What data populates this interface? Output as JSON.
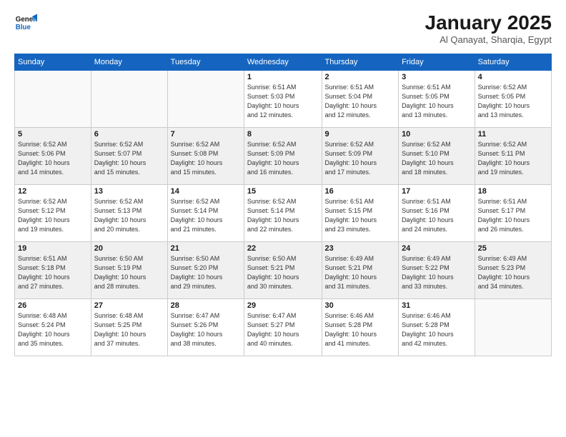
{
  "logo": {
    "line1": "General",
    "line2": "Blue"
  },
  "title": "January 2025",
  "subtitle": "Al Qanayat, Sharqia, Egypt",
  "weekdays": [
    "Sunday",
    "Monday",
    "Tuesday",
    "Wednesday",
    "Thursday",
    "Friday",
    "Saturday"
  ],
  "weeks": [
    [
      {
        "day": "",
        "info": ""
      },
      {
        "day": "",
        "info": ""
      },
      {
        "day": "",
        "info": ""
      },
      {
        "day": "1",
        "info": "Sunrise: 6:51 AM\nSunset: 5:03 PM\nDaylight: 10 hours\nand 12 minutes."
      },
      {
        "day": "2",
        "info": "Sunrise: 6:51 AM\nSunset: 5:04 PM\nDaylight: 10 hours\nand 12 minutes."
      },
      {
        "day": "3",
        "info": "Sunrise: 6:51 AM\nSunset: 5:05 PM\nDaylight: 10 hours\nand 13 minutes."
      },
      {
        "day": "4",
        "info": "Sunrise: 6:52 AM\nSunset: 5:05 PM\nDaylight: 10 hours\nand 13 minutes."
      }
    ],
    [
      {
        "day": "5",
        "info": "Sunrise: 6:52 AM\nSunset: 5:06 PM\nDaylight: 10 hours\nand 14 minutes."
      },
      {
        "day": "6",
        "info": "Sunrise: 6:52 AM\nSunset: 5:07 PM\nDaylight: 10 hours\nand 15 minutes."
      },
      {
        "day": "7",
        "info": "Sunrise: 6:52 AM\nSunset: 5:08 PM\nDaylight: 10 hours\nand 15 minutes."
      },
      {
        "day": "8",
        "info": "Sunrise: 6:52 AM\nSunset: 5:09 PM\nDaylight: 10 hours\nand 16 minutes."
      },
      {
        "day": "9",
        "info": "Sunrise: 6:52 AM\nSunset: 5:09 PM\nDaylight: 10 hours\nand 17 minutes."
      },
      {
        "day": "10",
        "info": "Sunrise: 6:52 AM\nSunset: 5:10 PM\nDaylight: 10 hours\nand 18 minutes."
      },
      {
        "day": "11",
        "info": "Sunrise: 6:52 AM\nSunset: 5:11 PM\nDaylight: 10 hours\nand 19 minutes."
      }
    ],
    [
      {
        "day": "12",
        "info": "Sunrise: 6:52 AM\nSunset: 5:12 PM\nDaylight: 10 hours\nand 19 minutes."
      },
      {
        "day": "13",
        "info": "Sunrise: 6:52 AM\nSunset: 5:13 PM\nDaylight: 10 hours\nand 20 minutes."
      },
      {
        "day": "14",
        "info": "Sunrise: 6:52 AM\nSunset: 5:14 PM\nDaylight: 10 hours\nand 21 minutes."
      },
      {
        "day": "15",
        "info": "Sunrise: 6:52 AM\nSunset: 5:14 PM\nDaylight: 10 hours\nand 22 minutes."
      },
      {
        "day": "16",
        "info": "Sunrise: 6:51 AM\nSunset: 5:15 PM\nDaylight: 10 hours\nand 23 minutes."
      },
      {
        "day": "17",
        "info": "Sunrise: 6:51 AM\nSunset: 5:16 PM\nDaylight: 10 hours\nand 24 minutes."
      },
      {
        "day": "18",
        "info": "Sunrise: 6:51 AM\nSunset: 5:17 PM\nDaylight: 10 hours\nand 26 minutes."
      }
    ],
    [
      {
        "day": "19",
        "info": "Sunrise: 6:51 AM\nSunset: 5:18 PM\nDaylight: 10 hours\nand 27 minutes."
      },
      {
        "day": "20",
        "info": "Sunrise: 6:50 AM\nSunset: 5:19 PM\nDaylight: 10 hours\nand 28 minutes."
      },
      {
        "day": "21",
        "info": "Sunrise: 6:50 AM\nSunset: 5:20 PM\nDaylight: 10 hours\nand 29 minutes."
      },
      {
        "day": "22",
        "info": "Sunrise: 6:50 AM\nSunset: 5:21 PM\nDaylight: 10 hours\nand 30 minutes."
      },
      {
        "day": "23",
        "info": "Sunrise: 6:49 AM\nSunset: 5:21 PM\nDaylight: 10 hours\nand 31 minutes."
      },
      {
        "day": "24",
        "info": "Sunrise: 6:49 AM\nSunset: 5:22 PM\nDaylight: 10 hours\nand 33 minutes."
      },
      {
        "day": "25",
        "info": "Sunrise: 6:49 AM\nSunset: 5:23 PM\nDaylight: 10 hours\nand 34 minutes."
      }
    ],
    [
      {
        "day": "26",
        "info": "Sunrise: 6:48 AM\nSunset: 5:24 PM\nDaylight: 10 hours\nand 35 minutes."
      },
      {
        "day": "27",
        "info": "Sunrise: 6:48 AM\nSunset: 5:25 PM\nDaylight: 10 hours\nand 37 minutes."
      },
      {
        "day": "28",
        "info": "Sunrise: 6:47 AM\nSunset: 5:26 PM\nDaylight: 10 hours\nand 38 minutes."
      },
      {
        "day": "29",
        "info": "Sunrise: 6:47 AM\nSunset: 5:27 PM\nDaylight: 10 hours\nand 40 minutes."
      },
      {
        "day": "30",
        "info": "Sunrise: 6:46 AM\nSunset: 5:28 PM\nDaylight: 10 hours\nand 41 minutes."
      },
      {
        "day": "31",
        "info": "Sunrise: 6:46 AM\nSunset: 5:28 PM\nDaylight: 10 hours\nand 42 minutes."
      },
      {
        "day": "",
        "info": ""
      }
    ]
  ]
}
